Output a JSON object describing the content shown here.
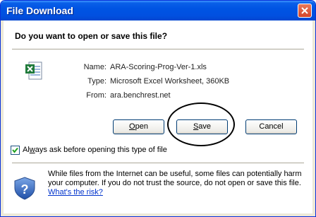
{
  "window": {
    "title": "File Download"
  },
  "dialog": {
    "question": "Do you want to open or save this file?",
    "fields": [
      {
        "label": "Name:",
        "value": "ARA-Scoring-Prog-Ver-1.xls"
      },
      {
        "label": "Type:",
        "value": "Microsoft Excel Worksheet, 360KB"
      },
      {
        "label": "From:",
        "value": "ara.benchrest.net"
      }
    ],
    "buttons": {
      "open": {
        "mnemonic": "O",
        "rest": "pen"
      },
      "save": {
        "mnemonic": "S",
        "rest": "ave"
      },
      "cancel": "Cancel"
    },
    "checkbox": {
      "pre": "Al",
      "mnemonic": "w",
      "post": "ays ask before opening this type of file",
      "checked": true
    },
    "warning": {
      "text": "While files from the Internet can be useful, some files can potentially harm your computer. If you do not trust the source, do not open or save this file. ",
      "link": "What's the risk?"
    }
  },
  "icons": {
    "file": "excel-file-icon",
    "security": "security-shield-icon",
    "close": "close-icon"
  },
  "colors": {
    "titlebar": "#0054e3",
    "annotation_circle": "#000000"
  }
}
